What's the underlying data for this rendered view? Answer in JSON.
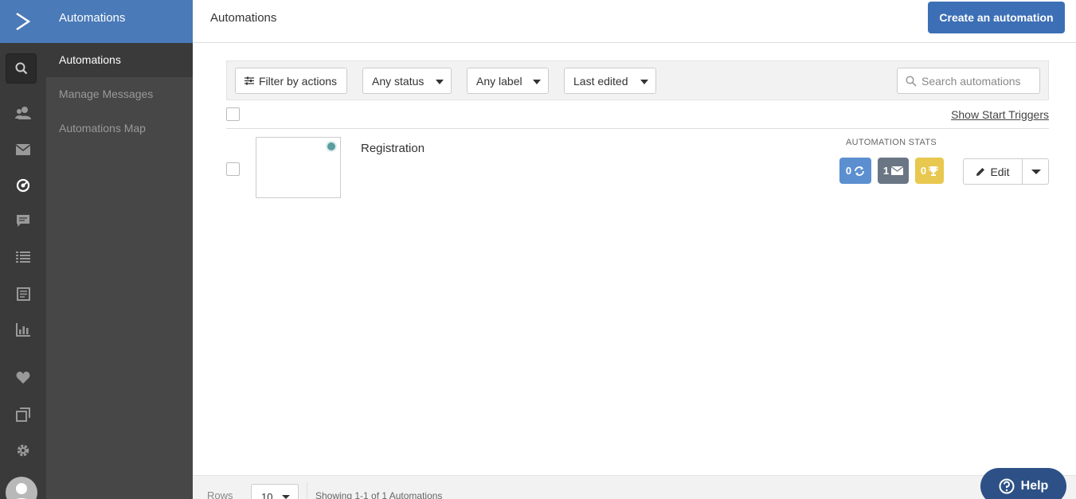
{
  "sidebar": {
    "section_title": "Automations",
    "items": [
      {
        "label": "Automations",
        "active": true
      },
      {
        "label": "Manage Messages",
        "active": false
      },
      {
        "label": "Automations Map",
        "active": false
      }
    ]
  },
  "rail": {
    "logo": "chevron-right-icon",
    "icons": [
      "search-icon",
      "contacts-icon",
      "envelope-icon",
      "automations-icon",
      "chat-icon",
      "list-icon",
      "forms-icon",
      "bar-chart-icon",
      "heart-icon",
      "pages-icon",
      "gear-icon"
    ]
  },
  "header": {
    "title": "Automations",
    "create_label": "Create an automation"
  },
  "filters": {
    "filter_actions_label": "Filter by actions",
    "status_label": "Any status",
    "label_label": "Any label",
    "sort_label": "Last edited",
    "search_placeholder": "Search automations"
  },
  "list": {
    "show_triggers_label": "Show Start Triggers",
    "automations": [
      {
        "name": "Registration",
        "stats_label": "AUTOMATION STATS",
        "stats": [
          {
            "value": "0",
            "icon": "refresh-icon",
            "color": "#5b8fd0"
          },
          {
            "value": "1",
            "icon": "envelope-icon",
            "color": "#6b7684"
          },
          {
            "value": "0",
            "icon": "trophy-icon",
            "color": "#e8c84e"
          }
        ],
        "edit_label": "Edit"
      }
    ]
  },
  "footer": {
    "rows_label": "Rows",
    "rows_value": "10",
    "showing_text": "Showing 1-1 of 1 Automations"
  },
  "help": {
    "label": "Help"
  },
  "colors": {
    "brand_blue": "#4a7ab8",
    "primary_button": "#3c6fb5",
    "rail_bg": "#3a3a3a",
    "subside_bg": "#474747",
    "help_bg": "#2d5186"
  }
}
